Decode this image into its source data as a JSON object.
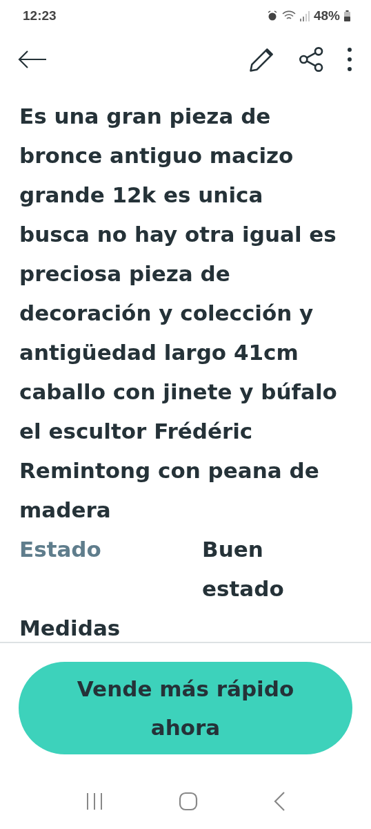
{
  "status_bar": {
    "time": "12:23",
    "battery": "48%"
  },
  "description": "Es una gran pieza de bronce antiguo macizo grande 12k es unica busca no hay otra igual es preciosa pieza de decoración y colección y antigüedad largo 41cm caballo con jinete y búfalo el escultor Frédéric Remintong con peana de madera",
  "details": [
    {
      "label": "Estado",
      "value": "Buen estado"
    },
    {
      "label": "Medidas"
    }
  ],
  "cta_button": "Vende más rápido ahora"
}
